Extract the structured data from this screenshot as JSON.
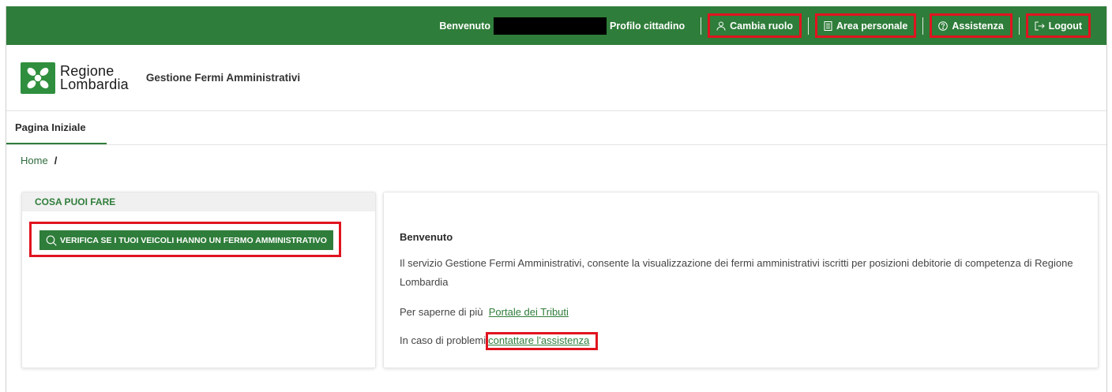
{
  "colors": {
    "brand_green": "#2f7d3a",
    "highlight_red": "#e0141f"
  },
  "topbar": {
    "welcome": "Benvenuto",
    "profile": "Profilo cittadino",
    "links": [
      {
        "label": "Cambia ruolo",
        "icon": "user-icon"
      },
      {
        "label": "Area personale",
        "icon": "document-icon"
      },
      {
        "label": "Assistenza",
        "icon": "help-circle-icon"
      },
      {
        "label": "Logout",
        "icon": "logout-icon"
      }
    ]
  },
  "header": {
    "logo_line1": "Regione",
    "logo_line2": "Lombardia",
    "app_title": "Gestione Fermi Amministrativi"
  },
  "nav": {
    "tab_label": "Pagina Iniziale"
  },
  "breadcrumb": {
    "home": "Home",
    "separator": "/"
  },
  "left_card": {
    "heading": "COSA PUOI FARE",
    "action_label": "VERIFICA SE I TUOI VEICOLI HANNO UN FERMO AMMINISTRATIVO",
    "action_icon": "search-icon"
  },
  "right_card": {
    "title": "Benvenuto",
    "description": "Il servizio Gestione Fermi Amministrativi, consente la visualizzazione dei fermi amministrativi iscritti per posizioni debitorie di competenza di Regione Lombardia",
    "more_prefix": "Per saperne di più",
    "more_link": "Portale dei Tributi",
    "problem_prefix": "In caso di problemi",
    "problem_link": "contattare l'assistenza"
  }
}
